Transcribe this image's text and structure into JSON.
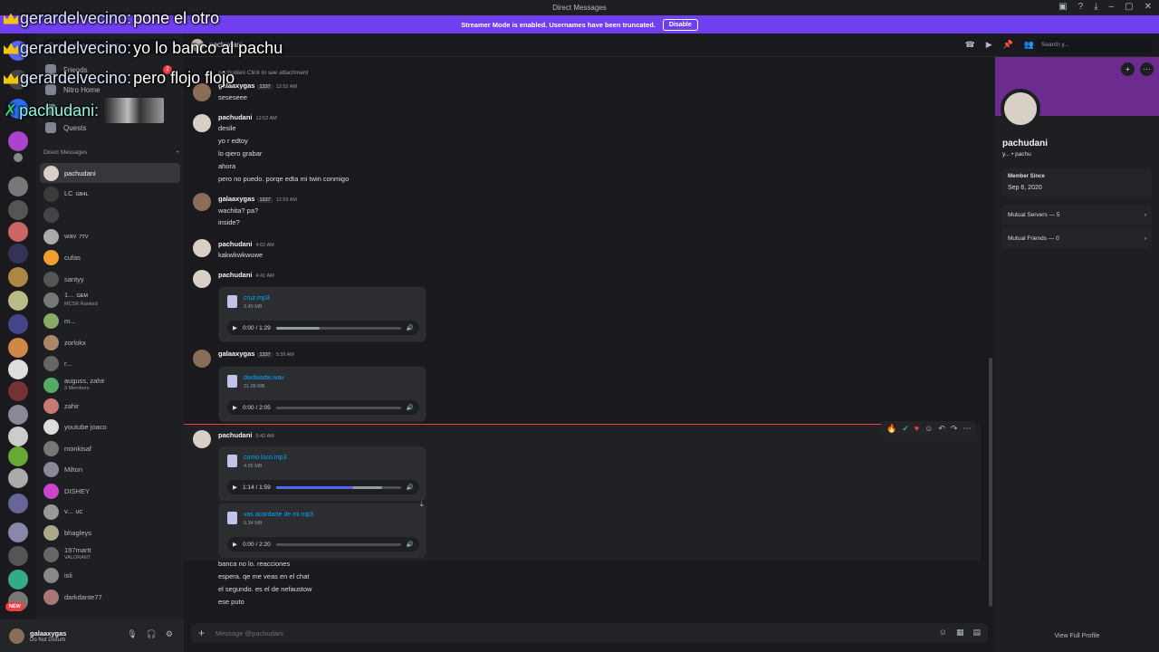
{
  "window": {
    "title": "Direct Messages"
  },
  "streamer_banner": {
    "text": "Streamer Mode is enabled. Usernames have been truncated.",
    "button": "Disable"
  },
  "sidebar": {
    "search_placeholder": "Find or start a conversation",
    "nav": [
      "Friends",
      "Nitro Home",
      "Shop",
      "Quests"
    ],
    "friends_badge": "2",
    "dm_header": "Direct Messages",
    "dms": [
      {
        "name": "pachudani",
        "tag": "",
        "sub": "",
        "color": "#d8cfc6"
      },
      {
        "name": "LC",
        "tag": "GB4L",
        "sub": "",
        "color": "#3b3b3b"
      },
      {
        "name": "",
        "tag": "",
        "sub": "",
        "color": "#444"
      },
      {
        "name": "wav",
        "tag": "7TV",
        "sub": "",
        "color": "#aaa"
      },
      {
        "name": "cufas",
        "tag": "",
        "sub": "",
        "color": "#f0a030"
      },
      {
        "name": "santyy",
        "tag": "",
        "sub": "",
        "color": "#555"
      },
      {
        "name": "1...",
        "tag": "GEM",
        "sub": "MCSR Ranked",
        "color": "#777"
      },
      {
        "name": "m...",
        "tag": "",
        "sub": "",
        "color": "#8a6"
      },
      {
        "name": "zorlokx",
        "tag": "",
        "sub": "",
        "color": "#a86"
      },
      {
        "name": "r...",
        "tag": "",
        "sub": "",
        "color": "#666"
      },
      {
        "name": "auguss, zahir",
        "tag": "",
        "sub": "3 Members",
        "color": "#5a6"
      },
      {
        "name": "zahir",
        "tag": "",
        "sub": "",
        "color": "#c77"
      },
      {
        "name": "youtube joaco",
        "tag": "",
        "sub": "",
        "color": "#ddd"
      },
      {
        "name": "monkisaf",
        "tag": "",
        "sub": "",
        "color": "#777"
      },
      {
        "name": "Milton",
        "tag": "",
        "sub": "",
        "color": "#889"
      },
      {
        "name": "DISHEY",
        "tag": "",
        "sub": "",
        "color": "#c4c"
      },
      {
        "name": "v...",
        "tag": "UC",
        "sub": "",
        "color": "#999"
      },
      {
        "name": "bhagleys",
        "tag": "",
        "sub": "",
        "color": "#aa8"
      },
      {
        "name": "197martt",
        "tag": "",
        "sub": "VALORANT",
        "color": "#666"
      },
      {
        "name": "isli",
        "tag": "",
        "sub": "",
        "color": "#888"
      },
      {
        "name": "darkdante77",
        "tag": "",
        "sub": "",
        "color": "#a77"
      }
    ]
  },
  "user_panel": {
    "name": "galaaxygas",
    "status": "Do Not Disturb"
  },
  "chat": {
    "header_name": "pachudani",
    "search_placeholder": "Search y...",
    "reply_preview": "pachudani Click to see attachment",
    "groups": [
      {
        "author": "galaaxygas",
        "badge": "1337",
        "time": "12:52 AM",
        "lines": [
          "seseseee"
        ]
      },
      {
        "author": "pachudani",
        "badge": "",
        "time": "12:52 AM",
        "lines": [
          "desile",
          "yo r edtoy",
          "lo qiero grabar",
          "ahora",
          "pero no puedo. porqe edta mi twin conmigo"
        ]
      },
      {
        "author": "galaaxygas",
        "badge": "1337",
        "time": "12:53 AM",
        "lines": [
          "wachita? pa?",
          "inside?"
        ]
      },
      {
        "author": "pachudani",
        "badge": "",
        "time": "4:02 AM",
        "lines": [
          "kakwkwkwuwe"
        ]
      },
      {
        "author": "pachudani",
        "badge": "",
        "time": "4:41 AM",
        "lines": []
      },
      {
        "author": "galaaxygas",
        "badge": "1337",
        "time": "5:38 AM",
        "lines": []
      },
      {
        "author": "pachudani",
        "badge": "",
        "time": "5:42 AM",
        "lines": []
      }
    ],
    "attachments": [
      {
        "name": "cruz.mp3",
        "size": "3.40 MB",
        "time": "0:00 / 1:29",
        "progress": 0,
        "buffered": 0.35
      },
      {
        "name": "dwdwadw.wav",
        "size": "21.08 MB",
        "time": "0:00 / 2:05",
        "progress": 0,
        "buffered": 0
      },
      {
        "name": "como loco.mp3",
        "size": "4.55 MB",
        "time": "1:14 / 1:59",
        "progress": 0.62,
        "buffered": 0.85
      },
      {
        "name": "vas acordarte de mi.mp3",
        "size": "5.34 MB",
        "time": "0:00 / 2:20",
        "progress": 0,
        "buffered": 0
      }
    ],
    "trailing_lines": [
      "banca no lo. reacciones",
      "espera. qe me veas en el chat",
      "el segundo. es el de nefaustow",
      "ese puto"
    ],
    "composer_placeholder": "Message @pachudani"
  },
  "profile": {
    "name": "pachudani",
    "sub": "y... • pachu",
    "member_since_label": "Member Since",
    "member_since": "Sep 6, 2020",
    "mutual_servers": "Mutual Servers — 5",
    "mutual_friends": "Mutual Friends — 0",
    "view_full": "View Full Profile"
  },
  "overlay": [
    {
      "name": "gerardelvecino:",
      "msg": "pone el otro"
    },
    {
      "name": "gerardelvecino:",
      "msg": "yo lo banco al pachu"
    },
    {
      "name": "gerardelvecino:",
      "msg": "pero flojo flojo"
    },
    {
      "name": "pachudani:",
      "msg": ""
    }
  ],
  "new_badge": "NEW"
}
